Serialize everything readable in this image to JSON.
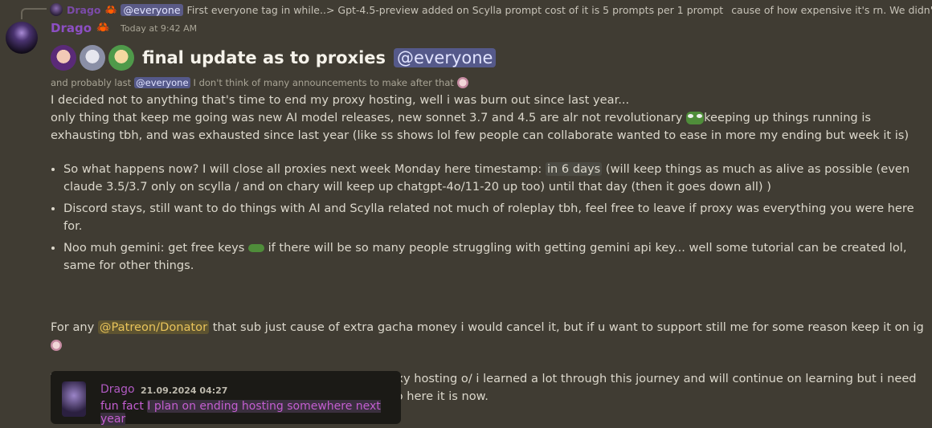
{
  "reply": {
    "author": "Drago",
    "mention": "@everyone",
    "preview": "First everyone tag in while..> Gpt-4.5-preview added on Scylla prompt cost of it is 5 prompts per 1 prompt",
    "preview_tail": "cause of how expensive it's rn.  We didn't hav..."
  },
  "message": {
    "author": "Drago",
    "timestamp": "Today at 9:42 AM",
    "title": "final update as to proxies",
    "title_mention": "@everyone",
    "sub_prefix": "and probably last",
    "sub_mention": "@everyone",
    "sub_suffix": "I don't think of many announcements to make after that",
    "line1": "I decided not to anything that's time to end my proxy hosting, well i was burn out since last year...",
    "line2a": "only thing that keep me going was new AI model releases, new sonnet 3.7 and 4.5 are alr not revolutionary",
    "line2b": "keeping up things running is exhausting tbh, and was exhausted since last year (like ss shows lol few people can collaborate wanted to ease in more my ending but week it is)",
    "bullet1a": "So what happens now? I will close all proxies next week Monday here timestamp:",
    "bullet1_highlight": "in 6 days",
    "bullet1b": "(will keep things as much as alive as possible (even claude 3.5/3.7 only on scylla / and on chary will keep up chatgpt-4o/11-20 up too) until that day (then it goes down all) )",
    "bullet2": "Discord stays, still want to do things with AI and Scylla related not much of roleplay tbh, feel free to leave if proxy was everything you were here for.",
    "bullet3a": "Noo muh gemini: get free keys",
    "bullet3b": "if there will be so many people struggling with getting gemini api key... well some tutorial can be created lol, same for other things.",
    "patreon_prefix": "For any",
    "patreon_role": "@Patreon/Donator",
    "patreon_suffix": "that sub just cause of extra gacha money i would cancel it, but if u want to support still me for some reason keep it on ig",
    "thanks_a": "Thanks to many people for support through my year of proxy hosting o/ i learned a lot through this journey and will continue on learning but  i need to move on i'm just too tired for a looonggg time now",
    "thanks_b": "so here it is now."
  },
  "quote": {
    "author": "Drago",
    "date": "21.09.2024 04:27",
    "text_a": "fun fact",
    "text_b": "I plan on ending hosting somewhere next year"
  }
}
